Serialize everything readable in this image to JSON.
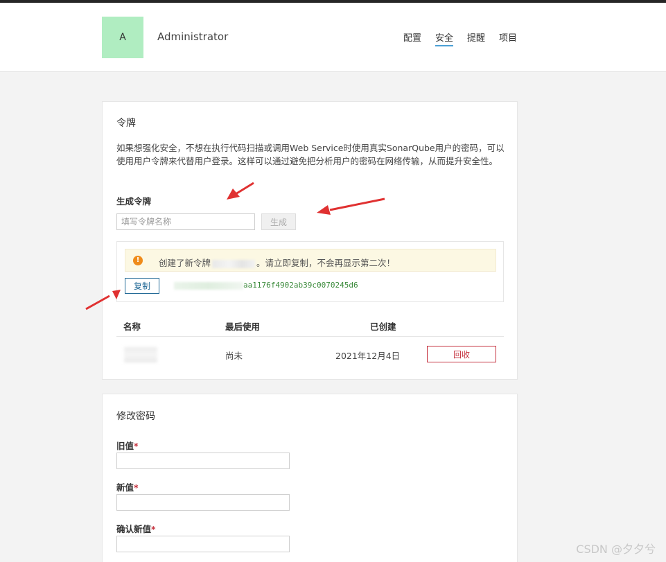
{
  "user": {
    "avatar_letter": "A",
    "name": "Administrator"
  },
  "nav": {
    "config": "配置",
    "security": "安全",
    "notifications": "提醒",
    "projects": "项目"
  },
  "tokens": {
    "title": "令牌",
    "description": "如果想强化安全，不想在执行代码扫描或调用Web Service时使用真实SonarQube用户的密码，可以使用用户令牌来代替用户登录。这样可以通过避免把分析用户的密码在网络传输，从而提升安全性。",
    "generate_label": "生成令牌",
    "name_placeholder": "填写令牌名称",
    "generate_button": "生成",
    "alert_prefix": "创建了新令牌",
    "alert_suffix": "。请立即复制，不会再显示第二次！",
    "copy_button": "复制",
    "token_value_visible": "aa1176f4902ab39c0070245d6",
    "table": {
      "headers": {
        "name": "名称",
        "last_used": "最后使用",
        "created": "已创建"
      },
      "rows": [
        {
          "last_used": "尚未",
          "created": "2021年12月4日",
          "revoke": "回收"
        }
      ]
    }
  },
  "password": {
    "title": "修改密码",
    "old_label": "旧值",
    "new_label": "新值",
    "confirm_label": "确认新值",
    "required_mark": "*"
  },
  "watermark": "CSDN @夕夕兮",
  "colors": {
    "accent": "#4b9fd5",
    "danger": "#c5313e",
    "avatar": "#b0edc1",
    "arrow": "#e03131"
  }
}
